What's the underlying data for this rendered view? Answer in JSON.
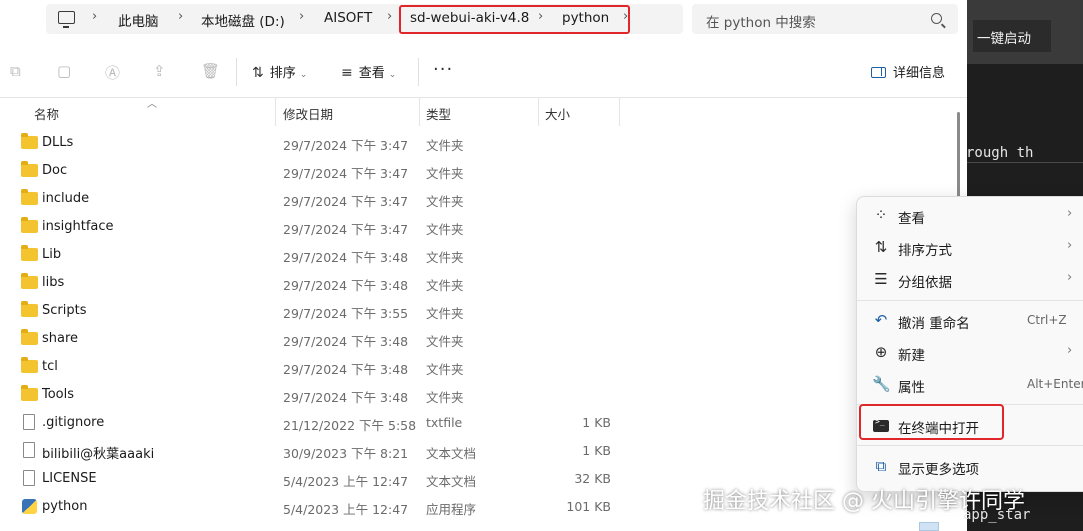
{
  "address": {
    "crumbs": [
      "此电脑",
      "本地磁盘 (D:)",
      "AISOFT",
      "sd-webui-aki-v4.8",
      "python"
    ],
    "chevron": "›"
  },
  "search": {
    "placeholder": "在 python 中搜索"
  },
  "toolbar": {
    "sort_label": "排序",
    "view_label": "查看",
    "more_label": "···",
    "details_label": "详细信息"
  },
  "columns": {
    "name": "名称",
    "modified": "修改日期",
    "type": "类型",
    "size": "大小"
  },
  "files": [
    {
      "name": "DLLs",
      "date": "29/7/2024 下午 3:47",
      "type": "文件夹",
      "size": "",
      "icon": "folder-icon"
    },
    {
      "name": "Doc",
      "date": "29/7/2024 下午 3:47",
      "type": "文件夹",
      "size": "",
      "icon": "folder-icon"
    },
    {
      "name": "include",
      "date": "29/7/2024 下午 3:47",
      "type": "文件夹",
      "size": "",
      "icon": "folder-icon"
    },
    {
      "name": "insightface",
      "date": "29/7/2024 下午 3:47",
      "type": "文件夹",
      "size": "",
      "icon": "folder-icon"
    },
    {
      "name": "Lib",
      "date": "29/7/2024 下午 3:48",
      "type": "文件夹",
      "size": "",
      "icon": "folder-icon"
    },
    {
      "name": "libs",
      "date": "29/7/2024 下午 3:48",
      "type": "文件夹",
      "size": "",
      "icon": "folder-icon"
    },
    {
      "name": "Scripts",
      "date": "29/7/2024 下午 3:55",
      "type": "文件夹",
      "size": "",
      "icon": "folder-icon"
    },
    {
      "name": "share",
      "date": "29/7/2024 下午 3:48",
      "type": "文件夹",
      "size": "",
      "icon": "folder-icon"
    },
    {
      "name": "tcl",
      "date": "29/7/2024 下午 3:48",
      "type": "文件夹",
      "size": "",
      "icon": "folder-icon"
    },
    {
      "name": "Tools",
      "date": "29/7/2024 下午 3:48",
      "type": "文件夹",
      "size": "",
      "icon": "folder-icon"
    },
    {
      "name": ".gitignore",
      "date": "21/12/2022 下午 5:58",
      "type": "txtfile",
      "size": "1 KB",
      "icon": "file-icon"
    },
    {
      "name": "bilibili@秋葉aaaki",
      "date": "30/9/2023 下午 8:21",
      "type": "文本文档",
      "size": "1 KB",
      "icon": "file-icon"
    },
    {
      "name": "LICENSE",
      "date": "5/4/2023 上午 12:47",
      "type": "文本文档",
      "size": "32 KB",
      "icon": "file-icon"
    },
    {
      "name": "python",
      "date": "5/4/2023 上午 12:47",
      "type": "应用程序",
      "size": "101 KB",
      "icon": "python-icon"
    }
  ],
  "app": {
    "button_label": "一键启动",
    "terminal_line1": "rough th",
    "terminal_line2": "app_star"
  },
  "context_menu": {
    "items": [
      {
        "label": "查看",
        "shortcut": "",
        "submenu": true,
        "icon": "grid-icon"
      },
      {
        "label": "排序方式",
        "shortcut": "",
        "submenu": true,
        "icon": "sort-icon"
      },
      {
        "label": "分组依据",
        "shortcut": "",
        "submenu": true,
        "icon": "group-icon"
      },
      {
        "label": "撤消 重命名",
        "shortcut": "Ctrl+Z",
        "submenu": false,
        "icon": "undo-icon"
      },
      {
        "label": "新建",
        "shortcut": "",
        "submenu": true,
        "icon": "new-icon"
      },
      {
        "label": "属性",
        "shortcut": "Alt+Enter",
        "submenu": false,
        "icon": "wrench-icon"
      },
      {
        "label": "在终端中打开",
        "shortcut": "",
        "submenu": false,
        "icon": "terminal-icon"
      },
      {
        "label": "显示更多选项",
        "shortcut": "",
        "submenu": false,
        "icon": "more-options-icon"
      }
    ],
    "arrow": "›"
  },
  "watermark": "掘金技术社区 @ 火山引擎许同学",
  "colors": {
    "highlight": "#e0262b",
    "folder": "#f4c430",
    "accent": "#1d5fa5"
  }
}
